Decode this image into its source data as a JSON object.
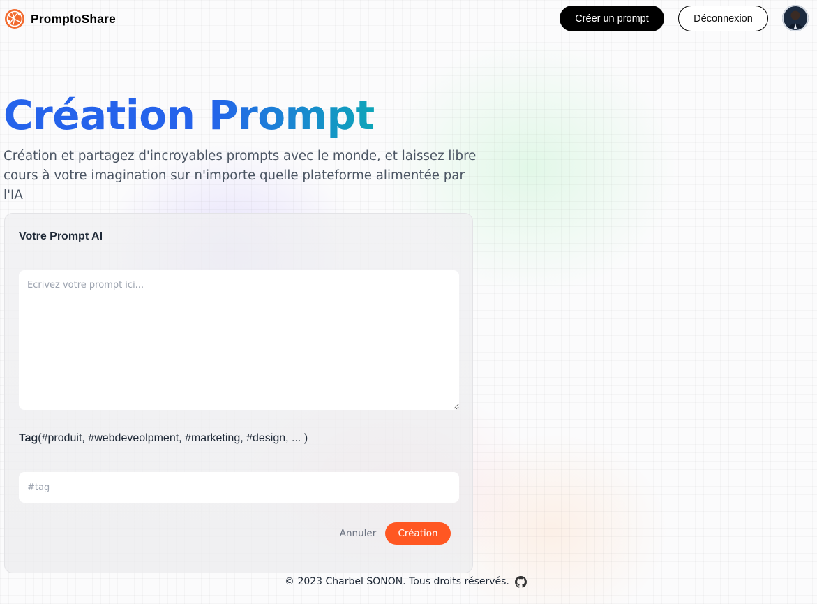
{
  "nav": {
    "brand_name": "PromptoShare",
    "create_button": "Créer un prompt",
    "logout_button": "Déconnexion"
  },
  "hero": {
    "title_part1": "Création",
    "title_part2": "Prompt",
    "description": "Création et partagez d'incroyables prompts avec le monde, et laissez libre cours à votre imagination sur n'importe quelle plateforme alimentée par l'IA"
  },
  "form": {
    "prompt_label": "Votre Prompt AI",
    "prompt_placeholder": "Ecrivez votre prompt ici...",
    "prompt_value": "",
    "tag_label_bold": "Tag",
    "tag_label_hint": "(#produit, #webdeveolpment, #marketing, #design, ... )",
    "tag_placeholder": "#tag",
    "tag_value": "",
    "cancel_label": "Annuler",
    "submit_label": "Création"
  },
  "footer": {
    "copyright": "© 2023 Charbel SONON. Tous droits réservés."
  },
  "colors": {
    "accent": "#ff5722",
    "title_blue": "#2563eb",
    "title_teal": "#0ea5b8",
    "nav_button": "#000000"
  },
  "icons": {
    "brand": "globe-logo-icon",
    "footer": "github-icon"
  }
}
